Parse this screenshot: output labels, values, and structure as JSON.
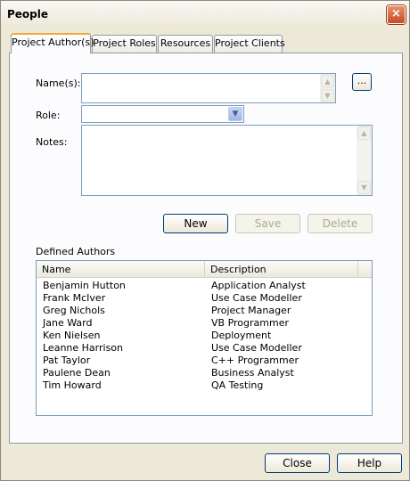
{
  "window": {
    "title": "People",
    "close_glyph": "×"
  },
  "tabs": [
    {
      "label": "Project Author(s)",
      "active": true
    },
    {
      "label": "Project Roles",
      "active": false
    },
    {
      "label": "Resources",
      "active": false
    },
    {
      "label": "Project Clients",
      "active": false
    }
  ],
  "form": {
    "names_label": "Name(s):",
    "names_value": "",
    "browse_label": "...",
    "role_label": "Role:",
    "role_value": "",
    "notes_label": "Notes:",
    "notes_value": ""
  },
  "actions": {
    "new_label": "New",
    "save_label": "Save",
    "delete_label": "Delete"
  },
  "authors": {
    "section_label": "Defined Authors",
    "columns": [
      "Name",
      "Description"
    ],
    "rows": [
      {
        "name": "Benjamin Hutton",
        "description": "Application Analyst"
      },
      {
        "name": "Frank McIver",
        "description": "Use Case Modeller"
      },
      {
        "name": "Greg Nichols",
        "description": "Project Manager"
      },
      {
        "name": "Jane Ward",
        "description": "VB Programmer"
      },
      {
        "name": "Ken Nielsen",
        "description": "Deployment"
      },
      {
        "name": "Leanne Harrison",
        "description": "Use Case Modeller"
      },
      {
        "name": "Pat Taylor",
        "description": "C++ Programmer"
      },
      {
        "name": "Paulene Dean",
        "description": "Business Analyst"
      },
      {
        "name": "Tim Howard",
        "description": "QA Testing"
      }
    ]
  },
  "footer": {
    "close_label": "Close",
    "help_label": "Help"
  },
  "icons": {
    "scroll_up": "▲",
    "scroll_down": "▼",
    "dropdown": "▼"
  }
}
